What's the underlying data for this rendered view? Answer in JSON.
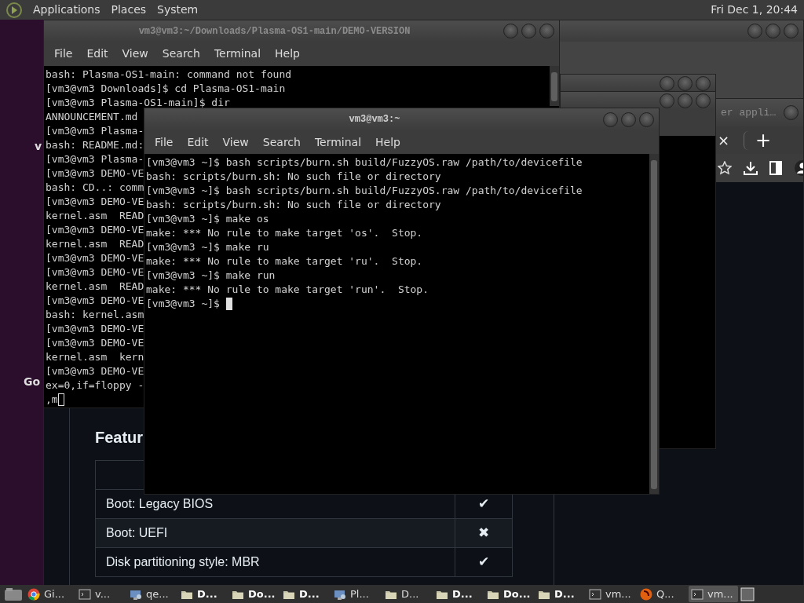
{
  "top_panel": {
    "menus": [
      "Applications",
      "Places",
      "System"
    ],
    "clock": "Fri Dec 1, 20:44"
  },
  "desktop_labels": [
    "v",
    "Go"
  ],
  "browser": {
    "title": "er appli…",
    "tab_close": "×",
    "new_tab": "+",
    "heading": "Featur",
    "table": {
      "rows": [
        {
          "feature": "Boot: Legacy BIOS",
          "mark": "✔"
        },
        {
          "feature": "Boot: UEFI",
          "mark": "✖"
        },
        {
          "feature": "Disk partitioning style: MBR",
          "mark": "✔"
        }
      ]
    }
  },
  "terminals": [
    {
      "title": "vm3@vm3:~/Downloads/Plasma-OS1-main/DEMO-VERSION",
      "focused": false,
      "menu": [
        "File",
        "Edit",
        "View",
        "Search",
        "Terminal",
        "Help"
      ],
      "lines": [
        "bash: Plasma-OS1-main: command not found",
        "[vm3@vm3 Downloads]$ cd Plasma-OS1-main",
        "[vm3@vm3 Plasma-OS1-main]$ dir",
        "ANNOUNCEMENT.md",
        "[vm3@vm3 Plasma-",
        "bash: README.md:",
        "[vm3@vm3 Plasma-",
        "[vm3@vm3 DEMO-VE",
        "bash: CD..: comm",
        "[vm3@vm3 DEMO-VE",
        "kernel.asm  READ",
        "[vm3@vm3 DEMO-VE",
        "kernel.asm  READ",
        "[vm3@vm3 DEMO-VE",
        "[vm3@vm3 DEMO-VE",
        "kernel.asm  READ",
        "[vm3@vm3 DEMO-VE",
        "bash: kernel.asm",
        "[vm3@vm3 DEMO-VE",
        "[vm3@vm3 DEMO-VE",
        "kernel.asm  kern",
        "[vm3@vm3 DEMO-VE",
        "ex=0,if=floppy -",
        ",m"
      ]
    },
    {
      "title": "vm3@vm3:~",
      "focused": true,
      "menu": [
        "File",
        "Edit",
        "View",
        "Search",
        "Terminal",
        "Help"
      ],
      "lines": [
        "[vm3@vm3 ~]$ bash scripts/burn.sh build/FuzzyOS.raw /path/to/devicefile",
        "bash: scripts/burn.sh: No such file or directory",
        "[vm3@vm3 ~]$ bash scripts/burn.sh build/FuzzyOS.raw /path/to/devicefile",
        "bash: scripts/burn.sh: No such file or directory",
        "[vm3@vm3 ~]$ make os",
        "make: *** No rule to make target 'os'.  Stop.",
        "[vm3@vm3 ~]$ make ru",
        "make: *** No rule to make target 'ru'.  Stop.",
        "[vm3@vm3 ~]$ make run",
        "make: *** No rule to make target 'run'.  Stop.",
        "[vm3@vm3 ~]$ "
      ]
    }
  ],
  "taskbar": {
    "items": [
      {
        "label": "Gi...",
        "kind": "browser",
        "selected": false,
        "highlighted": false
      },
      {
        "label": "v...",
        "kind": "terminal",
        "selected": false,
        "highlighted": false
      },
      {
        "label": "qe...",
        "kind": "vm",
        "selected": false,
        "highlighted": false
      },
      {
        "label": "D...",
        "kind": "folder",
        "selected": false,
        "highlighted": true
      },
      {
        "label": "Do...",
        "kind": "folder",
        "selected": false,
        "highlighted": true
      },
      {
        "label": "D...",
        "kind": "folder",
        "selected": false,
        "highlighted": true
      },
      {
        "label": "Pl...",
        "kind": "vm",
        "selected": false,
        "highlighted": false
      },
      {
        "label": "D...",
        "kind": "folder",
        "selected": false,
        "highlighted": false
      },
      {
        "label": "D...",
        "kind": "folder",
        "selected": false,
        "highlighted": true
      },
      {
        "label": "Do...",
        "kind": "folder",
        "selected": false,
        "highlighted": true
      },
      {
        "label": "D...",
        "kind": "folder",
        "selected": false,
        "highlighted": true
      },
      {
        "label": "vm...",
        "kind": "terminal",
        "selected": false,
        "highlighted": false
      },
      {
        "label": "Q...",
        "kind": "emulator",
        "selected": false,
        "highlighted": false
      },
      {
        "label": "vm...",
        "kind": "terminal",
        "selected": true,
        "highlighted": false
      }
    ]
  }
}
